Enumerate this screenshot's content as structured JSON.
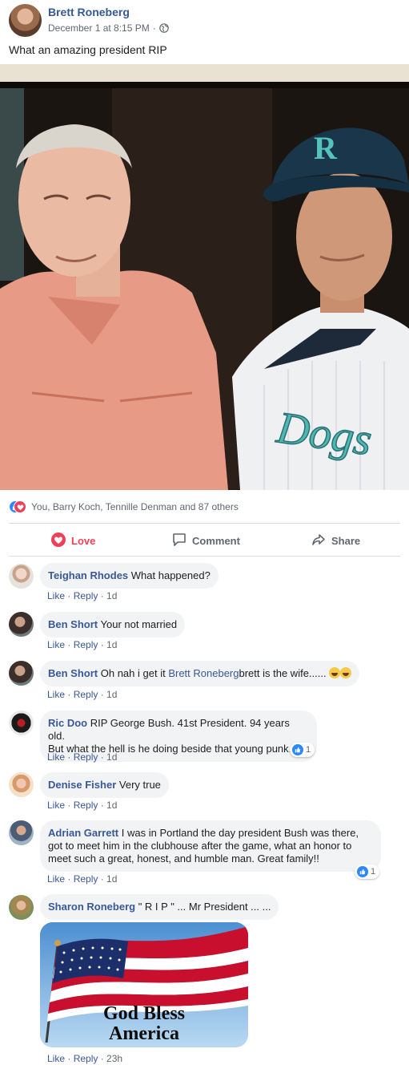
{
  "post": {
    "author": "Brett Roneberg",
    "timestamp": "December 1 at 8:15 PM",
    "separator": "·",
    "privacy_icon": "globe-icon",
    "text": "What an amazing president RIP"
  },
  "reactions": {
    "icons": [
      "like-icon",
      "love-icon"
    ],
    "summary": "You, Barry Koch, Tennille Denman and 87 others"
  },
  "actions": {
    "love": "Love",
    "comment": "Comment",
    "share": "Share"
  },
  "colors": {
    "link_blue": "#385898",
    "love_red": "#f33e58",
    "like_blue": "#2d88ff",
    "bubble_bg": "#f2f3f5"
  },
  "comments": [
    {
      "name": "Teighan Rhodes",
      "text": "What happened?",
      "like": "Like",
      "reply": "Reply",
      "time": "1d"
    },
    {
      "name": "Ben Short",
      "text": "Your not married",
      "like": "Like",
      "reply": "Reply",
      "time": "1d"
    },
    {
      "name": "Ben Short",
      "text_before": "Oh nah i get it",
      "mention": "Brett Roneberg",
      "text_after": "brett is the wife......",
      "like": "Like",
      "reply": "Reply",
      "time": "1d"
    },
    {
      "name": "Ric Doo",
      "line1": "RIP George Bush. 41st President. 94 years old.",
      "line2": "But what the hell is he doing beside that young punk.",
      "like": "Like",
      "reply": "Reply",
      "time": "1d",
      "reaction_count": "1"
    },
    {
      "name": "Denise Fisher",
      "text": "Very true",
      "like": "Like",
      "reply": "Reply",
      "time": "1d"
    },
    {
      "name": "Adrian Garrett",
      "line1": "I was in Portland the day president Bush was there,",
      "line2": "got to meet him in the clubhouse after the game, what an honor to",
      "line3": "meet such a great, honest, and humble man. Great family!!",
      "like": "Like",
      "reply": "Reply",
      "time": "1d",
      "reaction_count": "1"
    },
    {
      "name": "Sharon Roneberg",
      "text": "\" R I P \" ... Mr President ... ...",
      "image_caption_line1": "God Bless",
      "image_caption_line2": "America",
      "like": "Like",
      "reply": "Reply",
      "time": "23h"
    }
  ]
}
